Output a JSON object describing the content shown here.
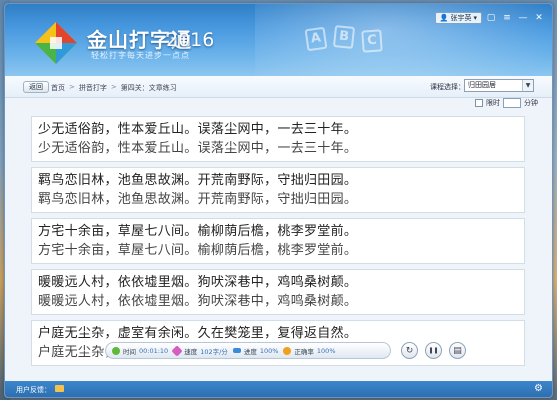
{
  "window": {
    "app_name": "金山打字通",
    "app_year": "2016",
    "slogan": "轻松打字每天进步一点点",
    "decor_letters": [
      "A",
      "B",
      "C"
    ],
    "user_name": "张宇英",
    "controls": {
      "skin": "▢",
      "menu": "≡",
      "minimize": "—",
      "close": "✕"
    }
  },
  "navbar": {
    "back_label": "返回",
    "breadcrumb": [
      "首页",
      "拼音打字",
      "第四关：文章练习"
    ],
    "separator": ">",
    "article_label": "课程选择：",
    "article_value": "归田园居"
  },
  "timer": {
    "label": "限时",
    "unit": "分钟"
  },
  "practice": {
    "groups": [
      {
        "source": "少无适俗韵，性本爱丘山。误落尘网中，一去三十年。",
        "typed": "少无适俗韵，性本爱丘山。误落尘网中，一去三十年。"
      },
      {
        "source": "羁鸟恋旧林，池鱼思故渊。开荒南野际，守拙归田园。",
        "typed": "羁鸟恋旧林，池鱼思故渊。开荒南野际，守拙归田园。"
      },
      {
        "source": "方宅十余亩，草屋七八间。榆柳荫后檐，桃李罗堂前。",
        "typed": "方宅十余亩，草屋七八间。榆柳荫后檐，桃李罗堂前。"
      },
      {
        "source": "暖暖远人村，依依墟里烟。狗吠深巷中，鸡鸣桑树颠。",
        "typed": "暖暖远人村，依依墟里烟。狗吠深巷中，鸡鸣桑树颠。"
      },
      {
        "source": "户庭无尘杂，虚室有余闲。久在樊笼里，复得返自然。",
        "typed": "户庭无尘杂，虚室有余闲。久在樊笼里，复得返自然。"
      }
    ]
  },
  "stats": {
    "time_label": "时间",
    "time_value": "00:01:10",
    "speed_label": "速度",
    "speed_value": "102字/分",
    "progress_label": "进度",
    "progress_value": "100%",
    "accuracy_label": "正确率",
    "accuracy_value": "100%"
  },
  "controls": {
    "restart_icon": "↻",
    "pause_icon": "❚❚",
    "report_icon": "▤"
  },
  "bottombar": {
    "message_label": "用户反馈：",
    "settings_icon": "⚙"
  },
  "colors": {
    "header_blue": "#2f7fc8",
    "bottom_blue": "#2d6fb0",
    "time_icon": "#5fb83a",
    "speed_icon": "#d45fc0",
    "progress_icon": "#3a8ad8",
    "accuracy_icon": "#f0a020"
  }
}
